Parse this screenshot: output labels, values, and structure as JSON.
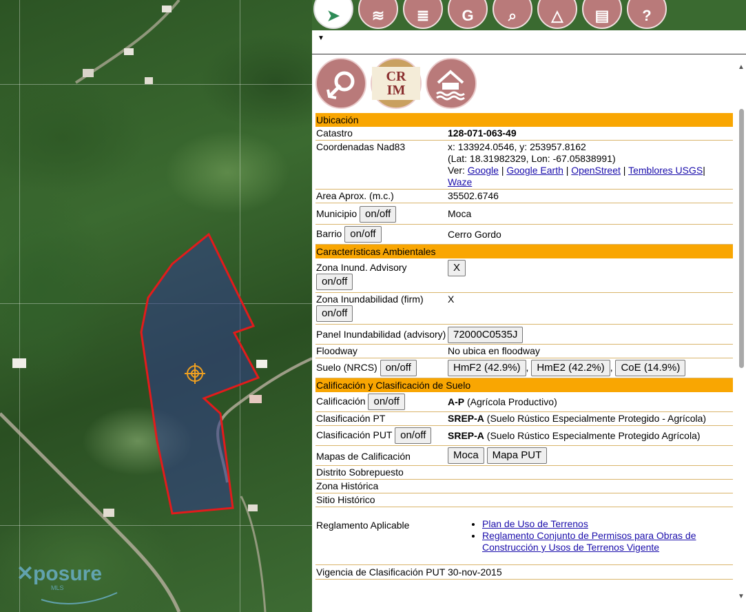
{
  "toolbar": {
    "tools": [
      {
        "icon": "maps-pin-icon",
        "glyph": "➤"
      },
      {
        "icon": "layers-icon",
        "glyph": "≋"
      },
      {
        "icon": "layers-stack-icon",
        "glyph": "≣"
      },
      {
        "icon": "gps-document-icon",
        "glyph": "G"
      },
      {
        "icon": "search-icon",
        "glyph": "⌕"
      },
      {
        "icon": "measure-icon",
        "glyph": "△"
      },
      {
        "icon": "print-icon",
        "glyph": "▤"
      },
      {
        "icon": "help-icon",
        "glyph": "?"
      }
    ]
  },
  "logos": {
    "crim_text": "CR IM"
  },
  "sections": {
    "ubicacion": "Ubicación",
    "ambientales": "Características Ambientales",
    "calificacion": "Calificación y Clasificación de Suelo"
  },
  "ubicacion": {
    "catastro_label": "Catastro",
    "catastro_value": "128-071-063-49",
    "coord_label": "Coordenadas Nad83",
    "coord_xy": "x: 133924.0546, y: 253957.8162",
    "coord_latlon": "(Lat: 18.31982329, Lon: -67.05838991)",
    "ver_label": "Ver:",
    "links": {
      "google": "Google",
      "google_earth": "Google Earth",
      "openstreet": "OpenStreet",
      "temblores": "Temblores USGS",
      "waze": "Waze"
    },
    "area_label": "Area Aprox. (m.c.)",
    "area_value": "35502.6746",
    "municipio_label": "Municipio",
    "municipio_value": "Moca",
    "barrio_label": "Barrio",
    "barrio_value": "Cerro Gordo"
  },
  "toggle_label": "on/off",
  "ambientales": {
    "zona_inund_adv_label": "Zona Inund. Advisory",
    "zona_inund_adv_value": "X",
    "zona_inund_firm_label": "Zona Inundabilidad (firm)",
    "zona_inund_firm_value": "X",
    "panel_label": "Panel Inundabilidad (advisory)",
    "panel_value": "72000C0535J",
    "floodway_label": "Floodway",
    "floodway_value": "No ubica en floodway",
    "suelo_label": "Suelo (NRCS)",
    "suelos": [
      "HmF2 (42.9%)",
      "HmE2 (42.2%)",
      "CoE (14.9%)"
    ]
  },
  "calificacion": {
    "calif_label": "Calificación",
    "calif_code": "A-P",
    "calif_desc": " (Agrícola Productivo)",
    "clas_pt_label": "Clasificación PT",
    "clas_pt_code": "SREP-A",
    "clas_pt_desc": " (Suelo Rústico Especialmente Protegido - Agrícola)",
    "clas_put_label": "Clasificación PUT",
    "clas_put_code": "SREP-A",
    "clas_put_desc": " (Suelo Rústico Especialmente Protegido Agrícola)",
    "mapas_label": "Mapas de Calificación",
    "mapas_buttons": [
      "Moca",
      "Mapa PUT"
    ],
    "distrito_label": "Distrito Sobrepuesto",
    "zona_hist_label": "Zona Histórica",
    "sitio_hist_label": "Sitio Histórico",
    "reglamento_label": "Reglamento Aplicable",
    "reglamentos": [
      "Plan de Uso de Terrenos",
      "Reglamento Conjunto de Permisos para Obras de Construcción y Usos de Terrenos Vigente"
    ],
    "vigencia_label": "Vigencia de Clasificación PUT",
    "vigencia_value": "30-nov-2015"
  },
  "map": {
    "watermark": "posure",
    "watermark_sub": "MLS"
  },
  "colors": {
    "section_header": "#f9a602",
    "parcel_outline": "#e31b1b",
    "tool_button": "#b97a7a"
  }
}
